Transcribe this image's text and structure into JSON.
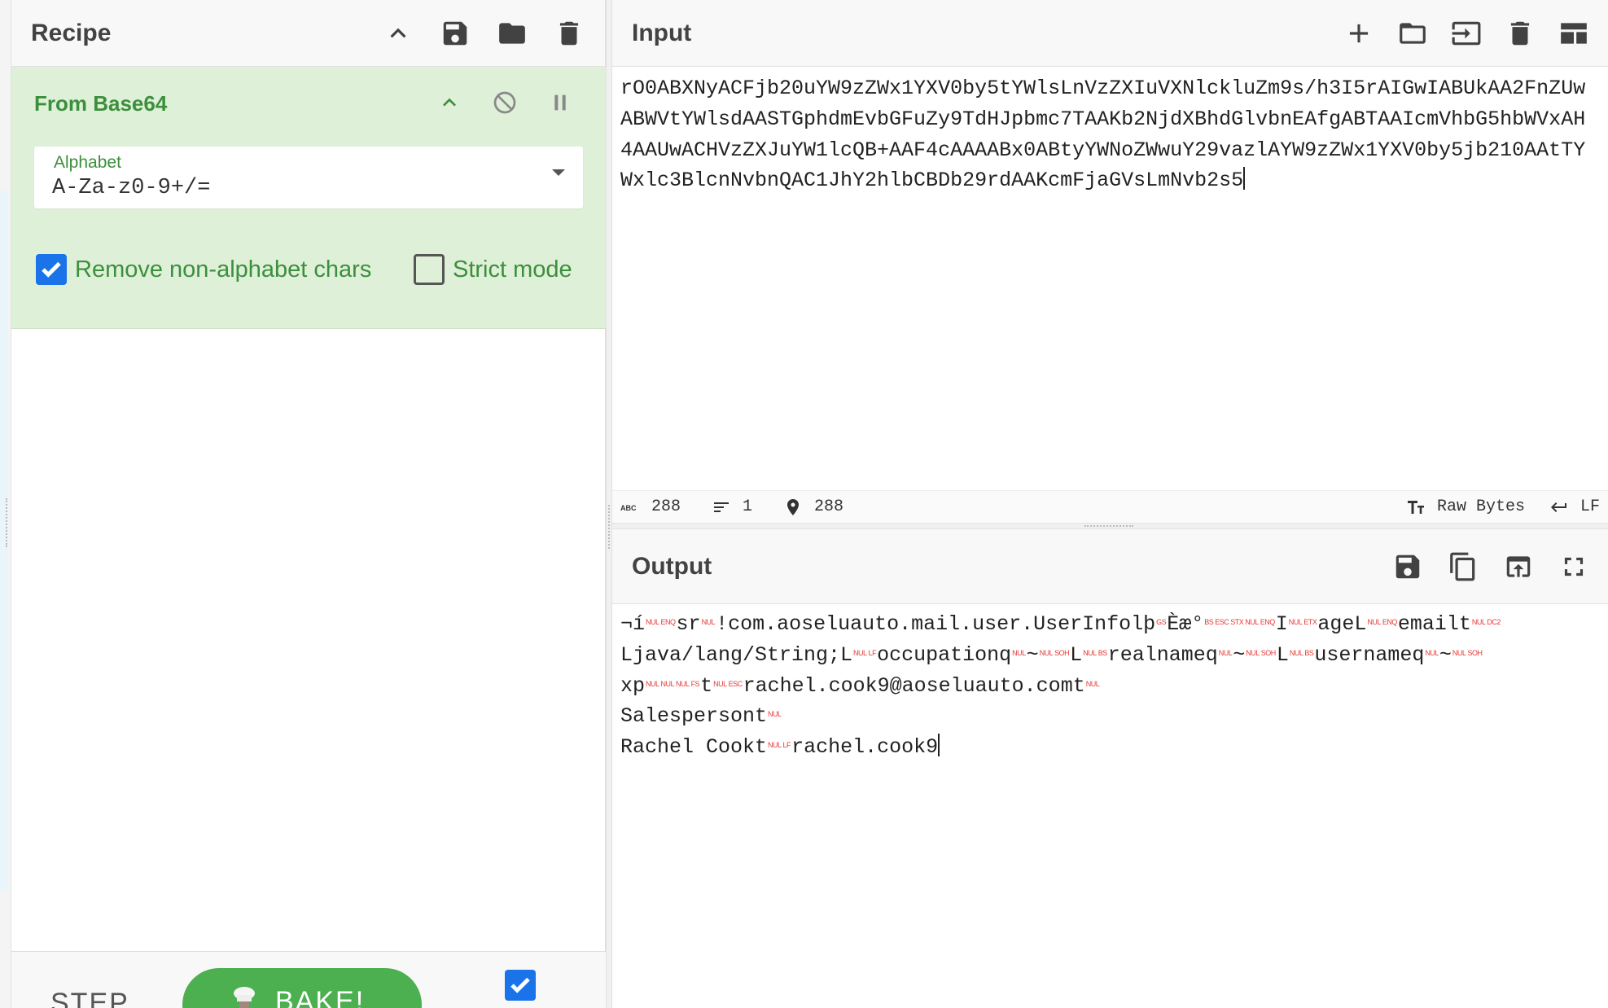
{
  "recipe": {
    "title": "Recipe",
    "operation": {
      "name": "From Base64",
      "alphabet_label": "Alphabet",
      "alphabet_value": "A-Za-z0-9+/=",
      "remove_non_alpha_label": "Remove non-alphabet chars",
      "remove_non_alpha_checked": true,
      "strict_mode_label": "Strict mode",
      "strict_mode_checked": false
    },
    "step_label": "STEP",
    "bake_label": "BAKE!",
    "auto_bake_checked": true
  },
  "input": {
    "title": "Input",
    "text": "rO0ABXNyACFjb20uYW9zZWx1YXV0by5tYWlsLnVzZXIuVXNlckluZm9s/h3I5rAIGwIABUkAA2FnZUwABWVtYWlsdAASTGphdmEvbGFuZy9TdHJpbmc7TAAKb2NjdXBhdGlvbnEAfgABTAAIcmVhbG5hbWVxAH4AAUwACHVzZXJuYW1lcQB+AAF4cAAAABx0ABtyYWNoZWwuY29vazlAYW9zZWx1YXV0by5jb210AAtTYWxlc3BlcnNvbnQAC1JhY2hlbCBDb29rdAAKcmFjaGVsLmNvb2s5",
    "status": {
      "length": "288",
      "lines": "1",
      "position": "288",
      "encoding": "Raw Bytes",
      "eol": "LF"
    }
  },
  "output": {
    "title": "Output",
    "lines": [
      [
        [
          "t",
          "¬í"
        ],
        [
          "c",
          "NUL"
        ],
        [
          "c",
          "ENQ"
        ],
        [
          "t",
          "sr"
        ],
        [
          "c",
          "NUL"
        ],
        [
          "t",
          "!com.aoseluauto.mail.user.UserInfolþ"
        ],
        [
          "c",
          "GS"
        ],
        [
          "t",
          "Èæ°"
        ],
        [
          "c",
          "BS"
        ],
        [
          "c",
          "ESC"
        ],
        [
          "c",
          "STX"
        ],
        [
          "c",
          "NUL"
        ],
        [
          "c",
          "ENQ"
        ],
        [
          "t",
          "I"
        ],
        [
          "c",
          "NUL"
        ],
        [
          "c",
          "ETX"
        ],
        [
          "t",
          "ageL"
        ],
        [
          "c",
          "NUL"
        ],
        [
          "c",
          "ENQ"
        ],
        [
          "t",
          "emailt"
        ],
        [
          "c",
          "NUL"
        ],
        [
          "c",
          "DC2"
        ]
      ],
      [
        [
          "t",
          "Ljava/lang/String;L"
        ],
        [
          "c",
          "NUL"
        ],
        [
          "c",
          "LF"
        ],
        [
          "t",
          "occupationq"
        ],
        [
          "c",
          "NUL"
        ],
        [
          "t",
          "~"
        ],
        [
          "c",
          "NUL"
        ],
        [
          "c",
          "SOH"
        ],
        [
          "t",
          "L"
        ],
        [
          "c",
          "NUL"
        ],
        [
          "c",
          "BS"
        ],
        [
          "t",
          "realnameq"
        ],
        [
          "c",
          "NUL"
        ],
        [
          "t",
          "~"
        ],
        [
          "c",
          "NUL"
        ],
        [
          "c",
          "SOH"
        ],
        [
          "t",
          "L"
        ],
        [
          "c",
          "NUL"
        ],
        [
          "c",
          "BS"
        ],
        [
          "t",
          "usernameq"
        ],
        [
          "c",
          "NUL"
        ],
        [
          "t",
          "~"
        ],
        [
          "c",
          "NUL"
        ],
        [
          "c",
          "SOH"
        ]
      ],
      [
        [
          "t",
          "xp"
        ],
        [
          "c",
          "NUL"
        ],
        [
          "c",
          "NUL"
        ],
        [
          "c",
          "NUL"
        ],
        [
          "c",
          "FS"
        ],
        [
          "t",
          "t"
        ],
        [
          "c",
          "NUL"
        ],
        [
          "c",
          "ESC"
        ],
        [
          "t",
          "rachel.cook9@aoseluauto.comt"
        ],
        [
          "c",
          "NUL"
        ]
      ],
      [
        [
          "t",
          "Salespersont"
        ],
        [
          "c",
          "NUL"
        ]
      ],
      [
        [
          "t",
          "Rachel Cookt"
        ],
        [
          "c",
          "NUL"
        ],
        [
          "c",
          "LF"
        ],
        [
          "t",
          "rachel.cook9"
        ]
      ]
    ]
  },
  "colors": {
    "operation_bg": "#dff0d8",
    "operation_text": "#3c8f3c",
    "checkbox_blue": "#1a73e8",
    "bake_green": "#4caf50",
    "control_char_red": "#e53935"
  }
}
